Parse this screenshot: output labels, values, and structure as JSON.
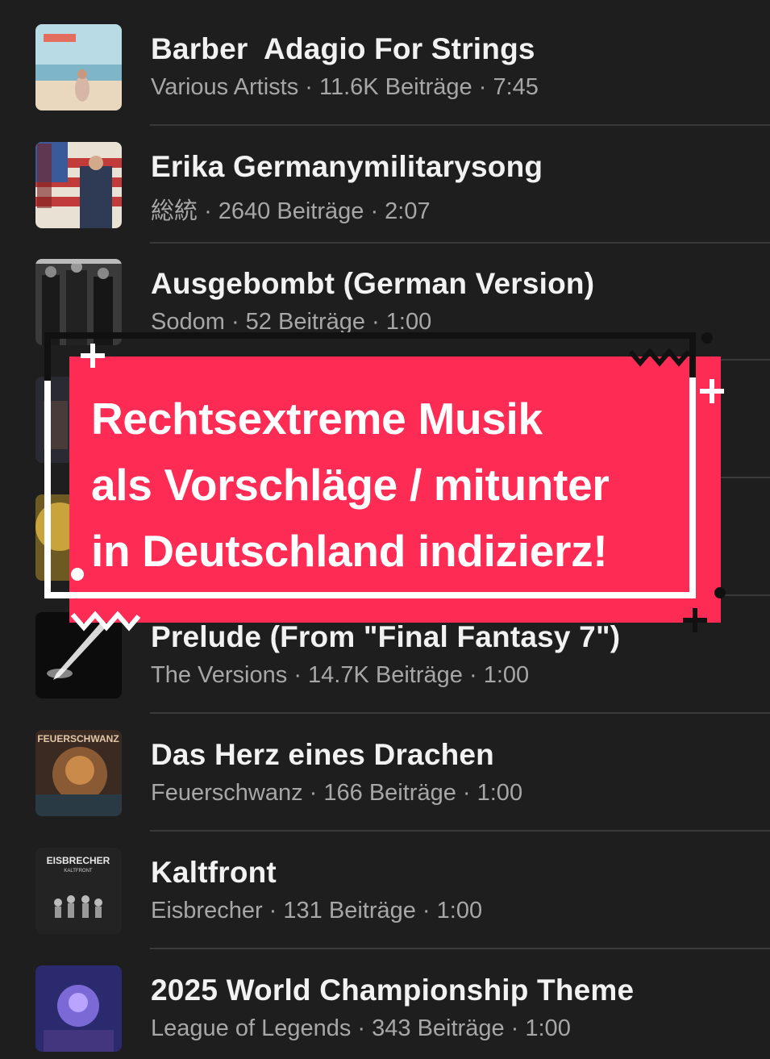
{
  "tracks": [
    {
      "title": "Barber  Adagio For Strings",
      "artist": "Various Artists",
      "posts": "11.6K Beiträge",
      "duration": "7:45",
      "cover": "beach-cover"
    },
    {
      "title": "Erika Germanymilitarysong",
      "artist": "総統",
      "posts": "2640 Beiträge",
      "duration": "2:07",
      "cover": "flag-cover"
    },
    {
      "title": "Ausgebombt (German Version)",
      "artist": "Sodom",
      "posts": "52 Beiträge",
      "duration": "1:00",
      "cover": "band-photo-cover"
    },
    {
      "title": "",
      "artist": "",
      "posts": "",
      "duration": "",
      "cover": "dark-cover"
    },
    {
      "title": "",
      "artist": "",
      "posts": "",
      "duration": "",
      "cover": "gold-cover"
    },
    {
      "title": "Prelude (From \"Final Fantasy 7\")",
      "artist": "The Versions",
      "posts": "14.7K Beiträge",
      "duration": "1:00",
      "cover": "sword-cover"
    },
    {
      "title": "Das Herz eines Drachen",
      "artist": "Feuerschwanz",
      "posts": "166 Beiträge",
      "duration": "1:00",
      "cover": "dragon-cover"
    },
    {
      "title": "Kaltfront",
      "artist": "Eisbrecher",
      "posts": "131 Beiträge",
      "duration": "1:00",
      "cover": "eisbrecher-cover"
    },
    {
      "title": "2025 World Championship Theme",
      "artist": "League of Legends",
      "posts": "343 Beiträge",
      "duration": "1:00",
      "cover": "championship-cover"
    }
  ],
  "covers_text": {
    "feuerschwanz": "FEUERSCHWANZ",
    "eisbrecher": "EISBRECHER",
    "kaltfront": "KALTFRONT"
  },
  "banner": {
    "line1": "Rechtsextreme Musik",
    "line2": "als Vorschläge / mitunter",
    "line3": "in Deutschland indizierz!"
  },
  "colors": {
    "background": "#1e1e1e",
    "accent": "#fe2b54",
    "title": "#f2f2f2",
    "meta": "#a7a7a7"
  }
}
